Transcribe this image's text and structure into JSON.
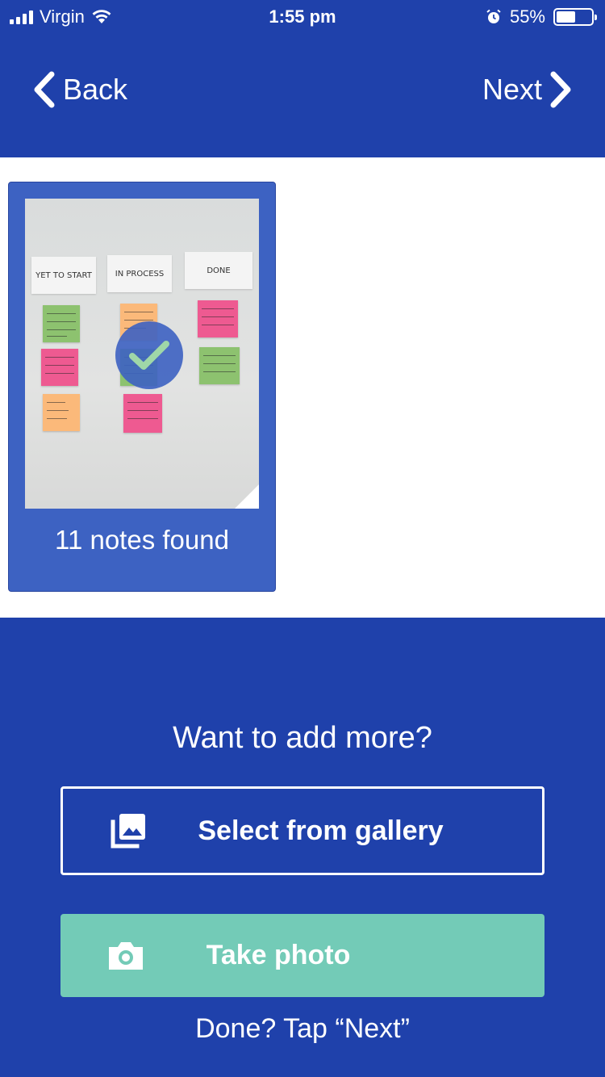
{
  "status_bar": {
    "carrier": "Virgin",
    "time": "1:55 pm",
    "battery_percent": "55%",
    "battery_level": 0.55
  },
  "nav": {
    "back_label": "Back",
    "next_label": "Next"
  },
  "capture": {
    "caption": "11 notes found",
    "board_labels": [
      "YET TO START",
      "IN PROCESS",
      "DONE"
    ]
  },
  "add_more": {
    "prompt": "Want to add more?",
    "gallery_label": "Select from gallery",
    "photo_label": "Take photo",
    "hint": "Done? Tap “Next”"
  },
  "colors": {
    "brand_blue": "#1f41ab",
    "card_blue": "#3d62c2",
    "teal": "#73cbb7",
    "sticky_green": "#8dc26f",
    "sticky_orange": "#fbb97a",
    "sticky_pink": "#ee5a91"
  },
  "icons": {
    "back": "chevron-left-icon",
    "next": "chevron-right-icon",
    "gallery": "photo-library-icon",
    "camera": "camera-icon",
    "selected": "check-icon"
  }
}
